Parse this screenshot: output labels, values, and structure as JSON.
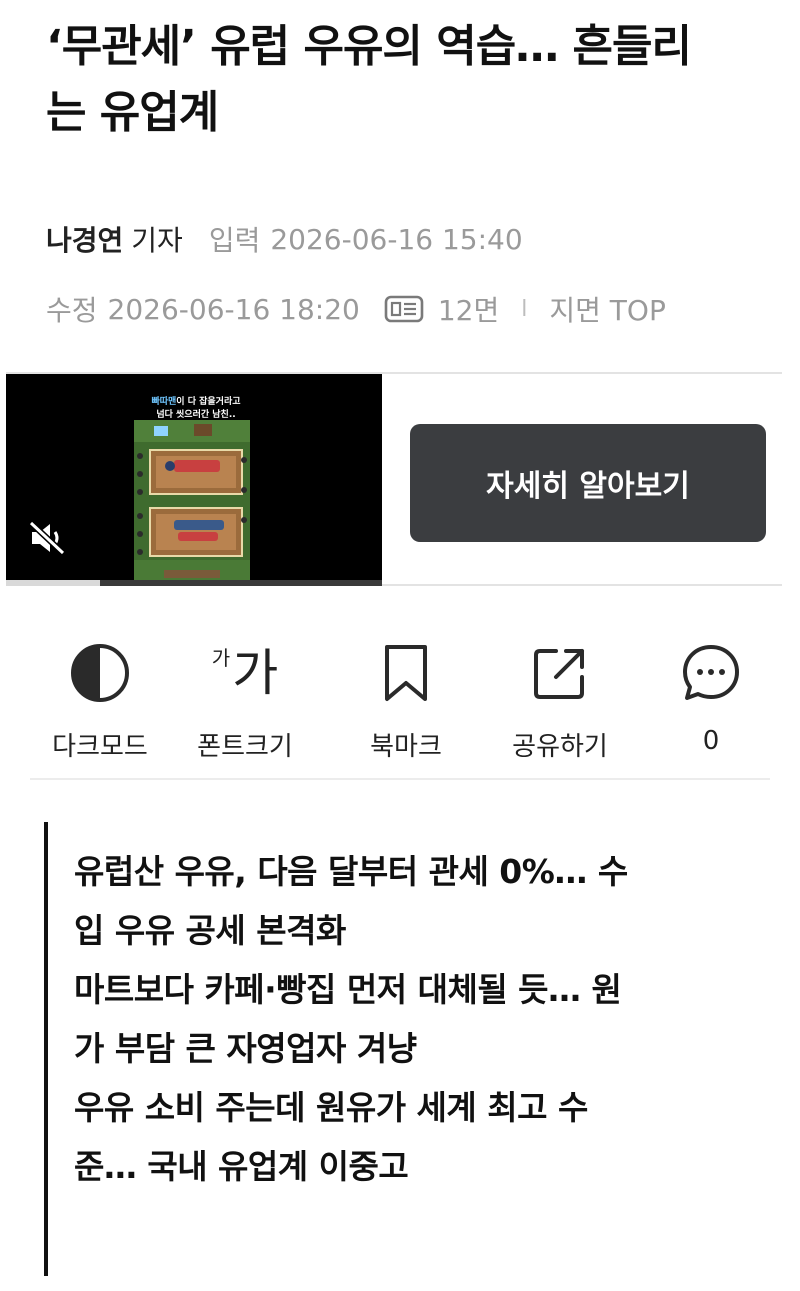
{
  "article": {
    "headline_line1": "‘무관세’ 유럽 우유의 역습… 흔들리",
    "headline_line2": "는 유업계",
    "reporter_name": "나경연",
    "reporter_role": "기자",
    "input_label": "입력",
    "input_time": "2026-06-16 15:40",
    "edit_label": "수정",
    "edit_time": "2026-06-16 18:20",
    "page_number": "12면",
    "separator": "l",
    "page_position": "지면 TOP"
  },
  "ad": {
    "video_caption_highlight": "빠따맨",
    "video_caption_line1_rest": "이 다 잡을거라고",
    "video_caption_line2": "넘다 씻으러간 남친..",
    "progress_fraction": 0.25,
    "cta_label": "자세히 알아보기",
    "mute_icon": "speaker-muted-icon"
  },
  "toolbar": {
    "dark_mode_label": "다크모드",
    "font_size_small_glyph": "가",
    "font_size_big_glyph": "가",
    "font_size_label": "폰트크기",
    "bookmark_label": "북마크",
    "share_label": "공유하기",
    "comment_count": "0"
  },
  "summary": {
    "items": [
      {
        "line1": "유럽산 우유, 다음 달부터 관세 0%… 수",
        "line2": "입 우유 공세 본격화"
      },
      {
        "line1": "마트보다 카페·빵집 먼저 대체될 듯… 원",
        "line2": "가 부담 큰 자영업자 겨냥"
      },
      {
        "line1": "우유 소비 주는데 원유가 세계 최고 수",
        "line2": "준… 국내 유업계 이중고"
      }
    ]
  }
}
